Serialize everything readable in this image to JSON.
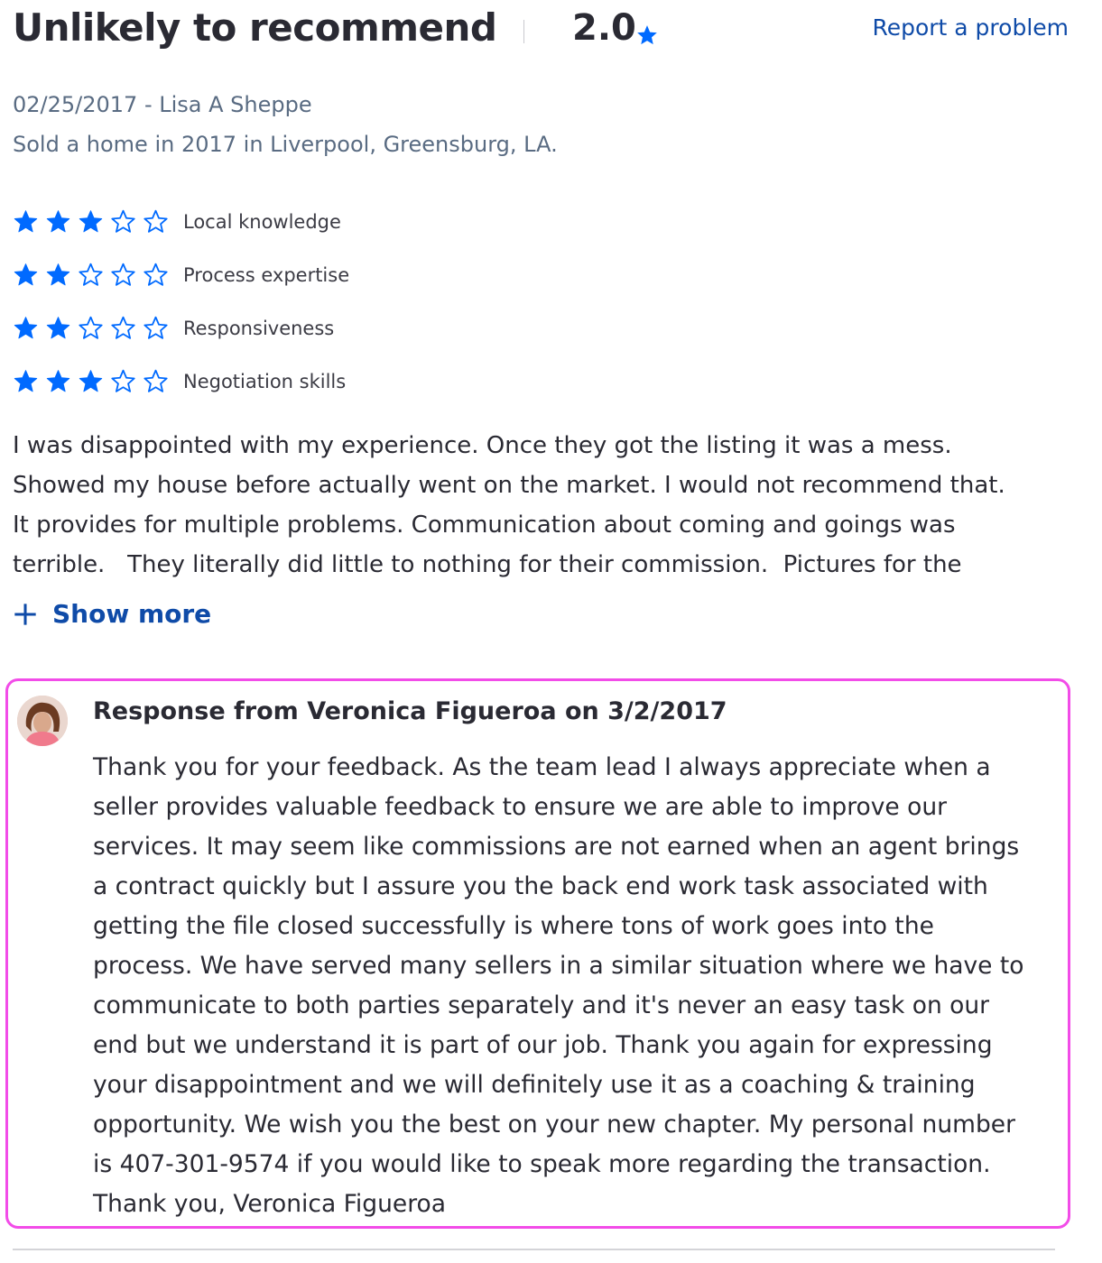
{
  "review": {
    "title": "Unlikely to recommend",
    "overall_rating": "2.0",
    "report_link": "Report a problem",
    "date_author": "02/25/2017 - Lisa A Sheppe",
    "transaction": "Sold a home in 2017 in Liverpool, Greensburg, LA.",
    "categories": [
      {
        "label": "Local knowledge",
        "stars": 3,
        "max": 5
      },
      {
        "label": "Process expertise",
        "stars": 2,
        "max": 5
      },
      {
        "label": "Responsiveness",
        "stars": 2,
        "max": 5
      },
      {
        "label": "Negotiation skills",
        "stars": 3,
        "max": 5
      }
    ],
    "lines": [
      "I was disappointed with my experience. Once they got the listing it was a mess.",
      "Showed my house before actually went on the market. I would not recommend that.",
      "It provides for multiple problems. Communication about coming and goings was",
      "terrible.   They literally did little to nothing for their commission.  Pictures for the"
    ],
    "show_more": "Show more"
  },
  "response": {
    "title": "Response from Veronica Figueroa on 3/2/2017",
    "lines": [
      "Thank you for your feedback. As the team lead I always appreciate when a",
      "seller provides valuable feedback to ensure we are able to improve our",
      "services. It may seem like commissions are not earned when an agent brings",
      "a contract quickly but I assure you the back end work task associated with",
      "getting the file closed successfully is where tons of work goes into the",
      "process. We have served many sellers in a similar situation where we have to",
      "communicate to both parties separately and it's never an easy task on our",
      "end but we understand it is part of our job. Thank you again for expressing",
      "your disappointment and we will definitely use it as a coaching & training",
      "opportunity. We wish you the best on your new chapter. My personal number",
      "is 407-301-9574 if you would like to speak more regarding the transaction.",
      "Thank you, Veronica Figueroa"
    ]
  },
  "colors": {
    "star_blue": "#006aff",
    "link_blue": "#0f4ba8",
    "response_border": "#f24ce8"
  }
}
